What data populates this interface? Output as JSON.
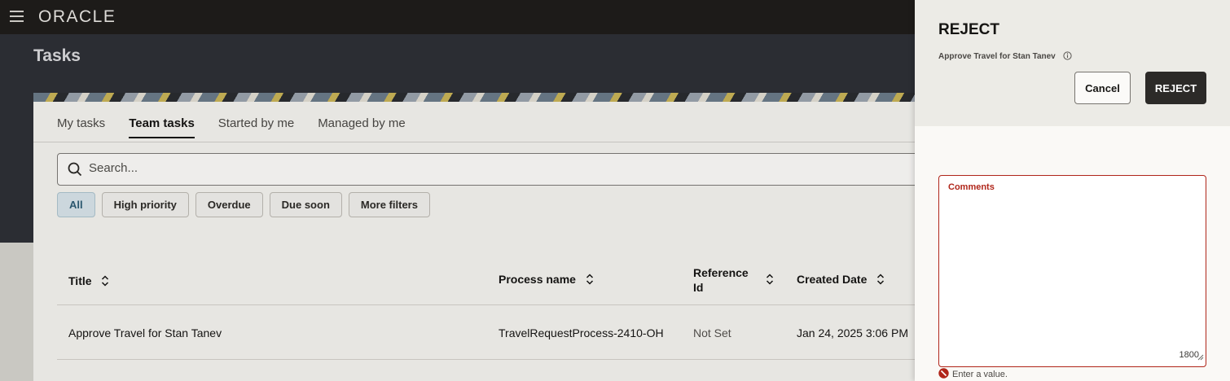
{
  "topbar": {
    "menu_icon": "hamburger-menu-icon",
    "logo": "ORACLE"
  },
  "page": {
    "title": "Tasks"
  },
  "tabs": [
    {
      "label": "My tasks",
      "active": false
    },
    {
      "label": "Team tasks",
      "active": true
    },
    {
      "label": "Started by me",
      "active": false
    },
    {
      "label": "Managed by me",
      "active": false
    }
  ],
  "search": {
    "placeholder": "Search...",
    "icon": "search-icon"
  },
  "filters": [
    {
      "label": "All",
      "selected": true
    },
    {
      "label": "High priority",
      "selected": false
    },
    {
      "label": "Overdue",
      "selected": false
    },
    {
      "label": "Due soon",
      "selected": false
    },
    {
      "label": "More filters",
      "selected": false
    }
  ],
  "table": {
    "columns": [
      {
        "label": "Title"
      },
      {
        "label": "Process name"
      },
      {
        "label": "Reference Id"
      },
      {
        "label": "Created Date"
      }
    ],
    "rows": [
      {
        "title": "Approve Travel for Stan Tanev",
        "process_name": "TravelRequestProcess-2410-OH",
        "reference_id": "Not Set",
        "created_date": "Jan 24, 2025 3:06 PM"
      }
    ]
  },
  "drawer": {
    "title": "REJECT",
    "subtitle": "Approve Travel for Stan Tanev",
    "cancel_label": "Cancel",
    "reject_label": "REJECT",
    "comments": {
      "label": "Comments",
      "value": "",
      "counter": "1800",
      "error": "Enter a value."
    }
  },
  "colors": {
    "topbar": "#1f1d1b",
    "header_band": "#2e3036",
    "error": "#b0261a",
    "selected_chip": "#d7e3e9",
    "primary_button": "#2c2a28"
  }
}
